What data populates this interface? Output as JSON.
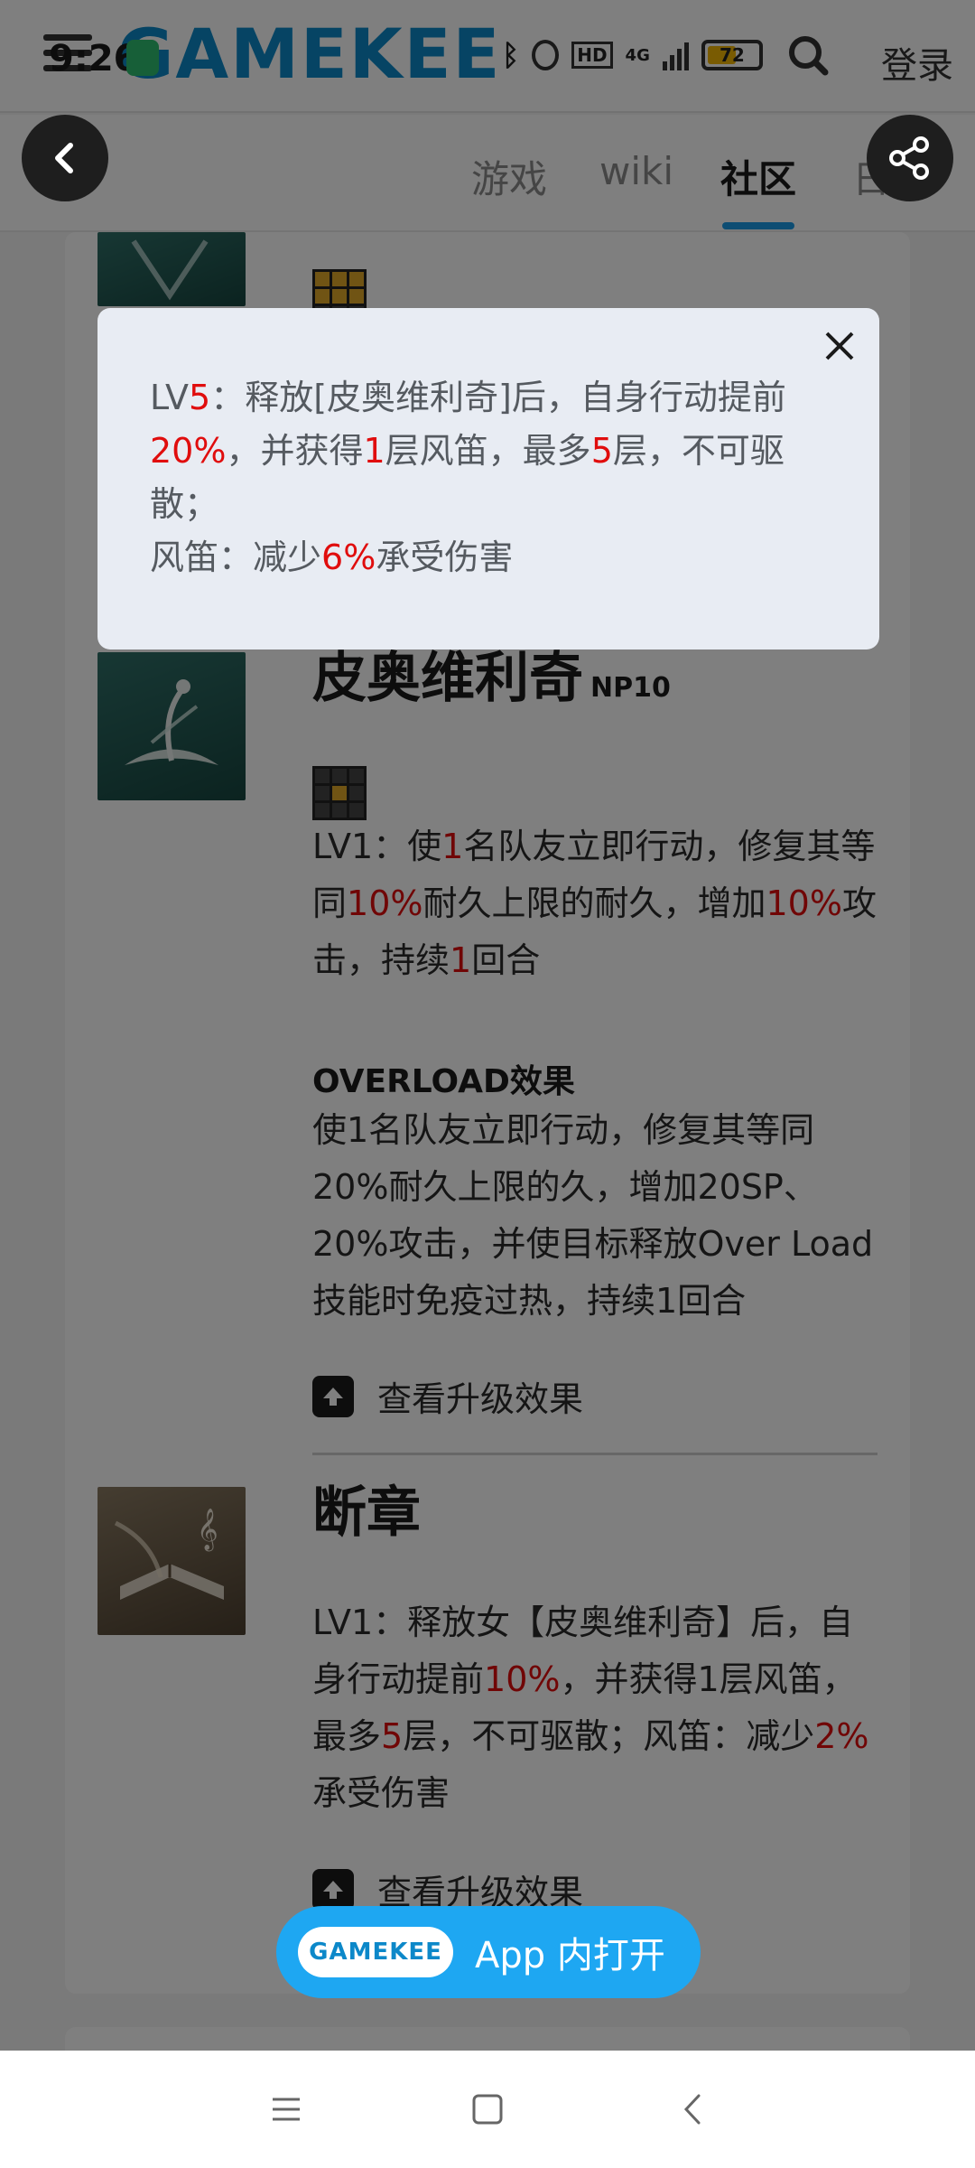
{
  "status_bar": {
    "time": "9:26",
    "network": "4G",
    "battery": "72"
  },
  "header": {
    "brand": "GAMEKEE",
    "login": "登录"
  },
  "tabs": [
    {
      "label": "游戏",
      "active": false
    },
    {
      "label": "wiki",
      "active": false
    },
    {
      "label": "社区",
      "active": true
    },
    {
      "label": "日历",
      "active": false
    }
  ],
  "skills": [
    {
      "name": "皮奥维利奇",
      "np": "NP10",
      "desc": [
        "LV1：使",
        "1",
        "名队友立即行动，修复其等同",
        "10%",
        "耐久上限的耐久，增加",
        "10%",
        "攻击，持续",
        "1",
        "回合"
      ],
      "overload_title": "OVERLOAD效果",
      "overload_desc": "使1名队友立即行动，修复其等同20%耐久上限的久，增加20SP、20%攻击，并使目标释放Over Load技能时免疫过热，持续1回合",
      "upgrade": "查看升级效果"
    },
    {
      "name": "断章",
      "desc": [
        "LV1：释放女【皮奥维利奇】后，自身行动提前",
        "10%",
        "，并获得1层风笛，最多",
        "5",
        "层，不可驱散；风笛：减少",
        "2%",
        "承受伤害"
      ],
      "upgrade": "查看升级效果"
    }
  ],
  "popup": {
    "parts": [
      "LV",
      "5",
      "：释放[皮奥维利奇]后，自身行动提前",
      "20%",
      "，并获得",
      "1",
      "层风笛，最多",
      "5",
      "层，不可驱散；"
    ],
    "line2": [
      "风笛：减少",
      "6%",
      "承受伤害"
    ]
  },
  "open_app": {
    "logo": "GAMEKEE",
    "label": "App 内打开"
  },
  "colors": {
    "accent": "#1b9be6",
    "highlight": "#e00d0d",
    "brand": "#0c88c9"
  }
}
